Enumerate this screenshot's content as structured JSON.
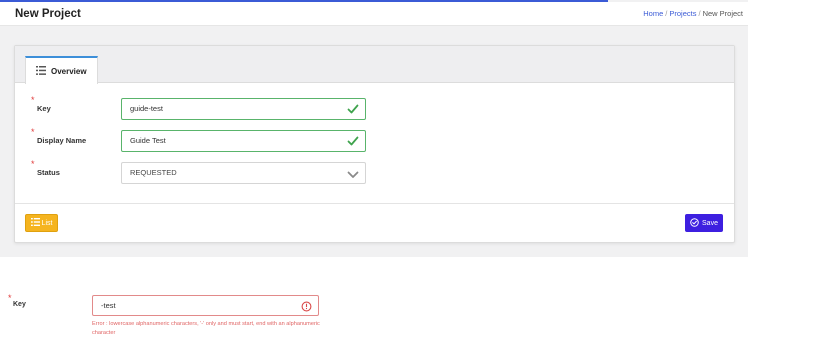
{
  "header": {
    "title": "New Project"
  },
  "breadcrumb": {
    "home": "Home",
    "projects": "Projects",
    "current": "New Project",
    "separator": "/"
  },
  "tabs": [
    {
      "label": "Overview"
    }
  ],
  "form": {
    "key": {
      "label": "Key",
      "required_mark": "*",
      "value": "guide-test"
    },
    "display_name": {
      "label": "Display Name",
      "required_mark": "*",
      "value": "Guide Test"
    },
    "status": {
      "label": "Status",
      "required_mark": "*",
      "value": "REQUESTED"
    }
  },
  "buttons": {
    "list_label": "List",
    "save_label": "Save"
  },
  "error_example": {
    "label": "Key",
    "required_mark": "*",
    "value": "-test",
    "message": "Error : lowercase alphanumeric characters, '-' only and must start, end with an alphanumeric character"
  },
  "colors": {
    "accent": "#3b5bd6",
    "valid": "#59b46b",
    "error": "#e06565",
    "list_button": "#f5b41f",
    "save_button": "#3d1fe0"
  },
  "icons": {
    "tab": "list-icon",
    "valid": "check-icon",
    "select": "chevron-down-icon",
    "list": "list-icon",
    "save": "check-circle-icon",
    "error": "alert-circle-icon"
  }
}
